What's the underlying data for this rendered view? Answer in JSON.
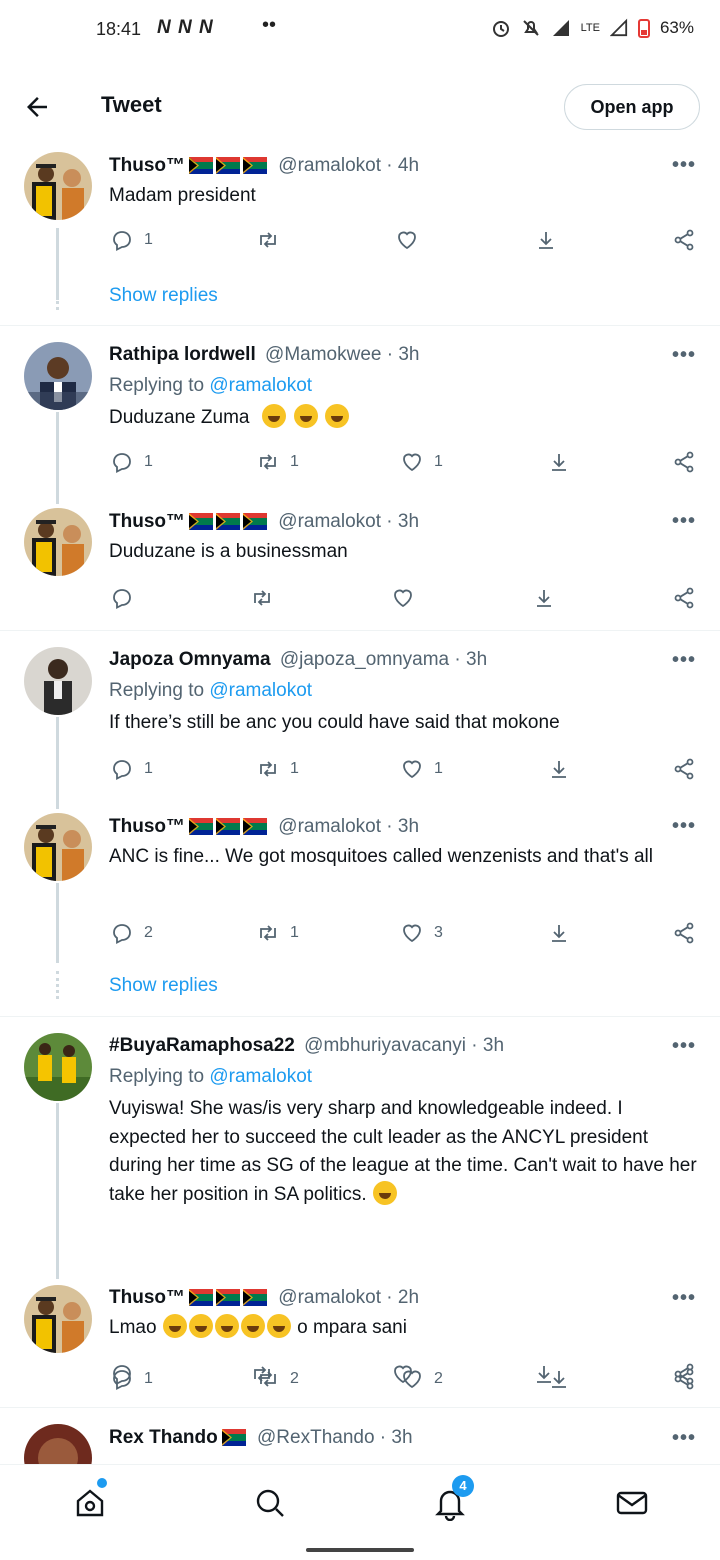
{
  "status_bar": {
    "time": "18:41",
    "notif_icons": "N N N",
    "battery": "63%",
    "network": "LTE"
  },
  "header": {
    "title": "Tweet",
    "open_app": "Open app"
  },
  "tweets": [
    {
      "name": "Thuso™",
      "handle": "@ramalokot · 4h",
      "text": "Madam president",
      "reply": "1",
      "retweet": "",
      "like": "",
      "show_replies": "Show replies"
    },
    {
      "name": "Rathipa lordwell",
      "handle": "@Mamokwee · 3h",
      "replying_label": "Replying to",
      "replying_to": "@ramalokot",
      "text": "Duduzane Zuma",
      "reply": "1",
      "retweet": "1",
      "like": "1"
    },
    {
      "name": "Thuso™",
      "handle": "@ramalokot · 3h",
      "text": "Duduzane is a businessman",
      "reply": "",
      "retweet": "",
      "like": ""
    },
    {
      "name": "Japoza Omnyama",
      "handle": "@japoza_omnyama · 3h",
      "replying_label": "Replying to",
      "replying_to": "@ramalokot",
      "text": "If there’s still be anc you could have said that mokone",
      "reply": "1",
      "retweet": "1",
      "like": "1"
    },
    {
      "name": "Thuso™",
      "handle": "@ramalokot · 3h",
      "text": "ANC is fine... We got mosquitoes called wenzenists and that's all",
      "reply": "2",
      "retweet": "1",
      "like": "3",
      "show_replies": "Show replies"
    },
    {
      "name": "#BuyaRamaphosa22",
      "handle": "@mbhuriyavacanyi · 3h",
      "replying_label": "Replying to",
      "replying_to": "@ramalokot",
      "text": "Vuyiswa! She was/is very sharp and knowledgeable indeed. I expected her to succeed the cult leader as the ANCYL president during her time as SG of the league at the time. Can't wait to have her take her position in SA politics.",
      "reply": "1",
      "retweet": "2",
      "like": "2"
    },
    {
      "name": "Thuso™",
      "handle": "@ramalokot · 2h",
      "text": "Lmao",
      "text_after": "o mpara sani",
      "reply": "",
      "retweet": "",
      "like": ""
    },
    {
      "name": "Rex Thando",
      "handle": "@RexThando · 3h"
    }
  ],
  "nav": {
    "notifications_badge": "4"
  },
  "colors": {
    "accent": "#1d9bf0",
    "muted": "#536471",
    "text": "#0f1419",
    "line": "#cfd9de"
  }
}
